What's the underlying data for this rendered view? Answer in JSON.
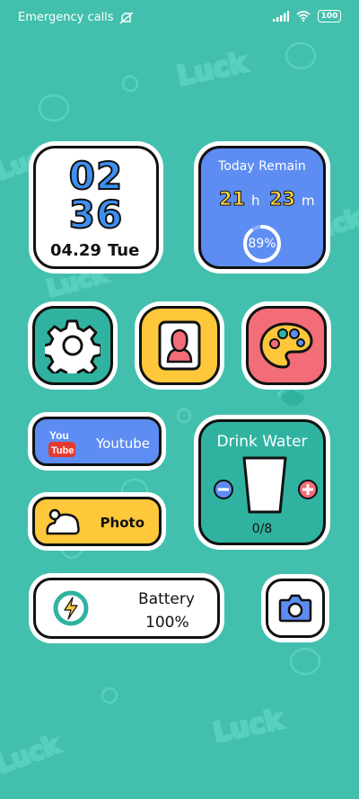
{
  "status_bar": {
    "carrier": "Emergency calls",
    "battery": "100"
  },
  "clock": {
    "hours": "02",
    "minutes": "36",
    "date": "04.29",
    "day": "Tue"
  },
  "today_remain": {
    "title": "Today Remain",
    "hours": "21",
    "hours_unit": "h",
    "minutes": "23",
    "minutes_unit": "m",
    "percent": "89%",
    "progress": 0.89
  },
  "apps": {
    "settings": "settings-gear-icon",
    "contacts": "contact-card-icon",
    "theme": "palette-icon"
  },
  "youtube": {
    "logo_you": "You",
    "logo_tube": "Tube",
    "label": "Youtube"
  },
  "photo": {
    "label": "Photo"
  },
  "water": {
    "title": "Drink Water",
    "count": "0/8"
  },
  "battery": {
    "label": "Battery",
    "value": "100%"
  },
  "colors": {
    "background": "#42c0ad",
    "blue": "#5d8df2",
    "yellow": "#ffc83a",
    "teal": "#2fb3a0",
    "red": "#f26d78"
  },
  "decorations": [
    "Luck",
    "Luck",
    "Luck",
    "Luck",
    "Luck",
    "Luck"
  ]
}
